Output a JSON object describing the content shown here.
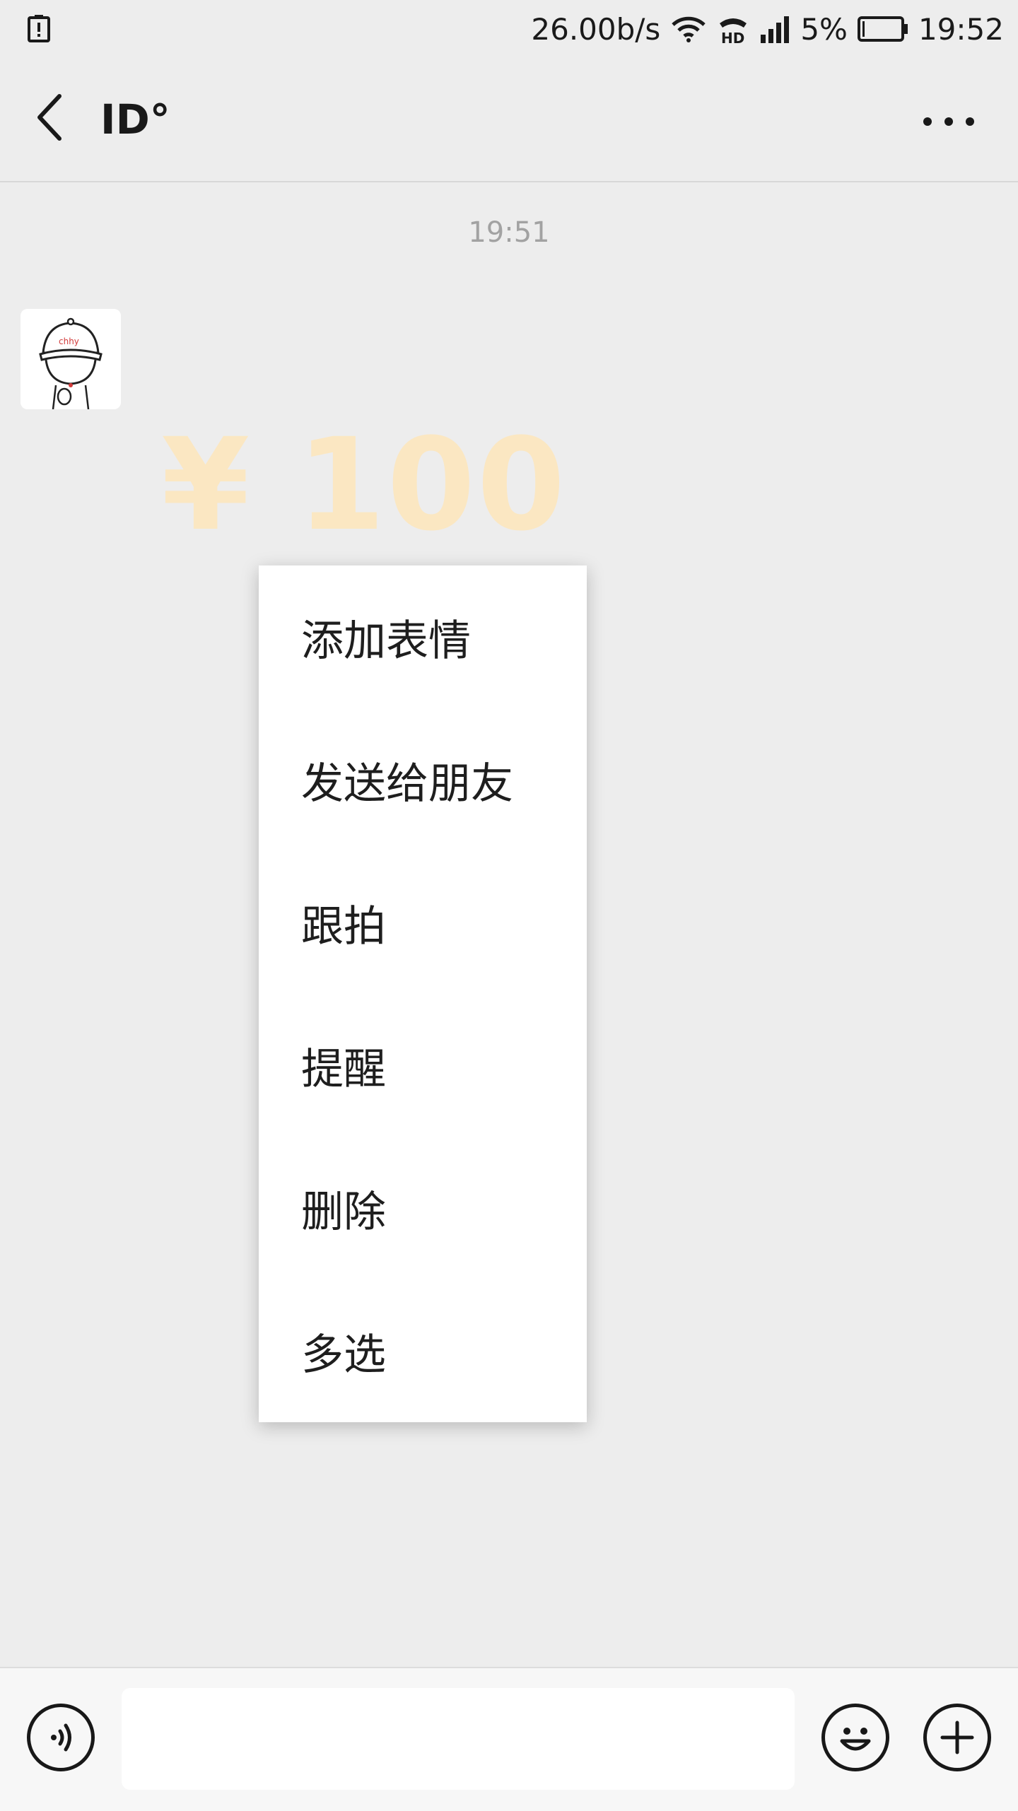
{
  "status_bar": {
    "network_speed": "26.00b/s",
    "battery_percent": "5%",
    "time": "19:52"
  },
  "nav": {
    "title": "ID°"
  },
  "chat": {
    "timestamp": "19:51",
    "sticker_text": "¥ 100"
  },
  "context_menu": {
    "items": [
      "添加表情",
      "发送给朋友",
      "跟拍",
      "提醒",
      "删除",
      "多选"
    ]
  },
  "input_bar": {
    "placeholder": ""
  },
  "colors": {
    "background": "#ededed",
    "sticker_text": "#fbe7c2",
    "menu_background": "#ffffff"
  }
}
